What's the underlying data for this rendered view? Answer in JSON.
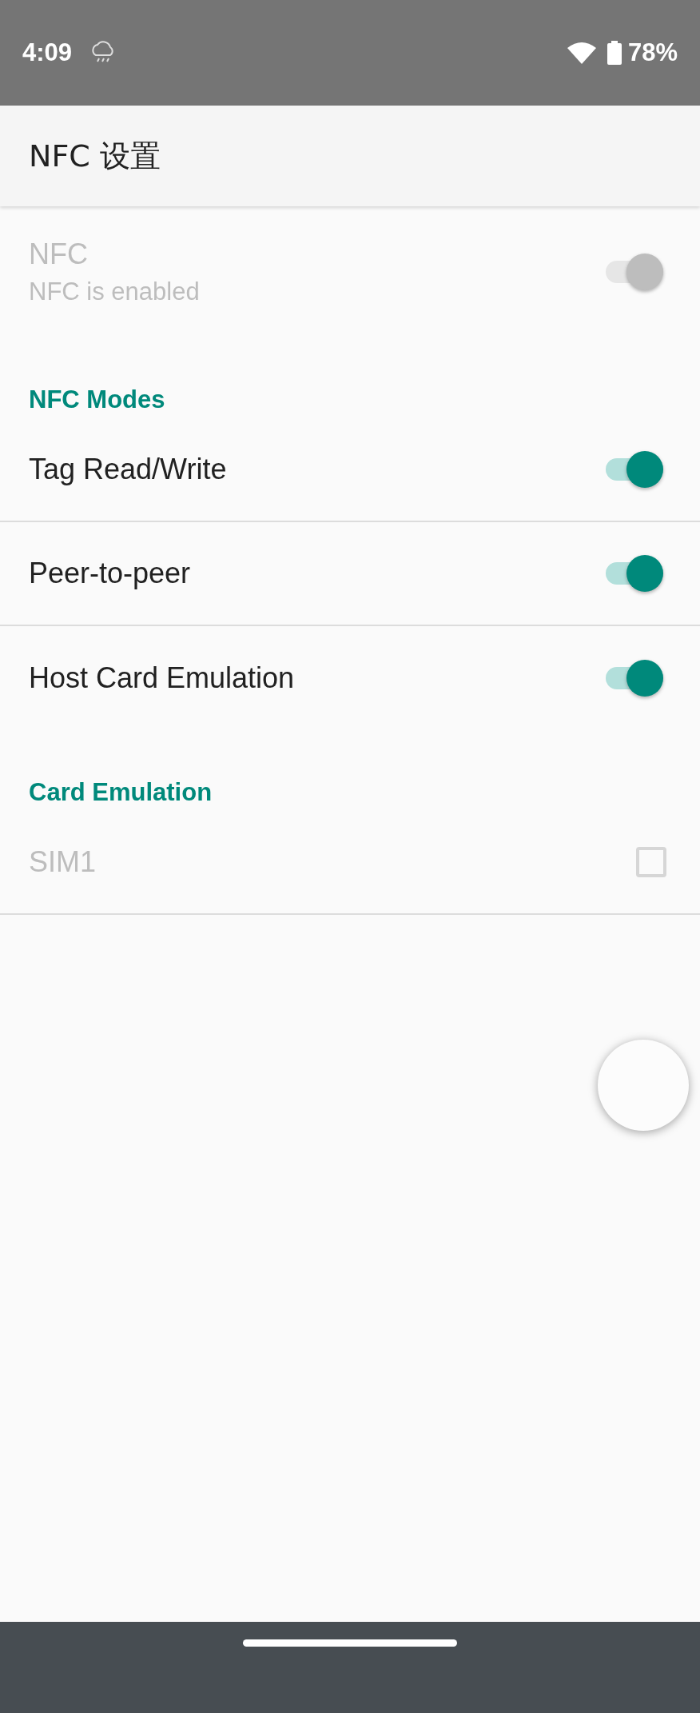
{
  "status_bar": {
    "time": "4:09",
    "battery": "78%"
  },
  "app_bar": {
    "title": "NFC 设置"
  },
  "preferences": [
    {
      "kind": "switch",
      "title": "NFC",
      "summary": "NFC is enabled",
      "on": true,
      "disabled": true
    },
    {
      "kind": "header",
      "title": "NFC Modes"
    },
    {
      "kind": "switch",
      "title": "Tag Read/Write",
      "on": true,
      "disabled": false
    },
    {
      "kind": "switch",
      "title": "Peer-to-peer",
      "on": true,
      "disabled": false
    },
    {
      "kind": "switch",
      "title": "Host Card Emulation",
      "on": true,
      "disabled": false
    },
    {
      "kind": "header",
      "title": "Card Emulation"
    },
    {
      "kind": "checkbox",
      "title": "SIM1",
      "checked": false,
      "disabled": true
    }
  ]
}
